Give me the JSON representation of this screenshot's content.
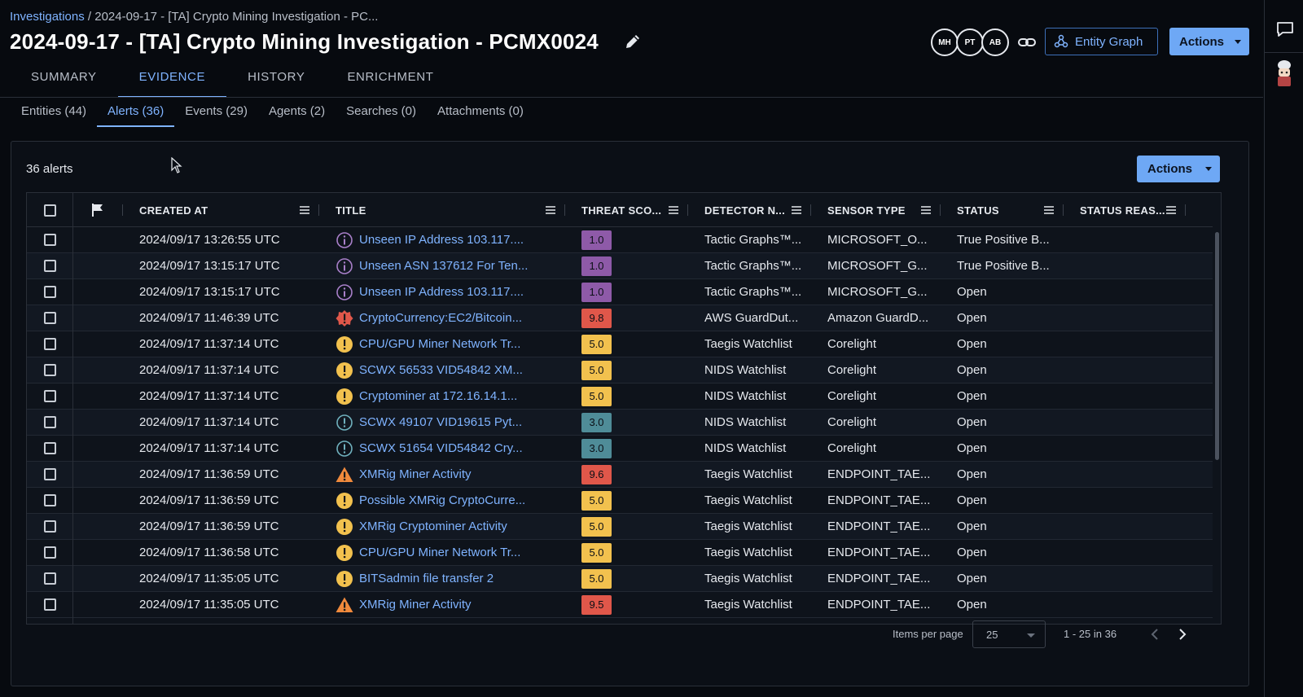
{
  "breadcrumb": {
    "root": "Investigations",
    "separator": " / ",
    "current": "2024-09-17 - [TA] Crypto Mining Investigation - PC..."
  },
  "page_title": "2024-09-17 - [TA] Crypto Mining Investigation - PCMX0024",
  "header": {
    "avatars": [
      "MH",
      "PT",
      "AB"
    ],
    "entity_graph_label": "Entity Graph",
    "actions_label": "Actions"
  },
  "tabs": [
    "SUMMARY",
    "EVIDENCE",
    "HISTORY",
    "ENRICHMENT"
  ],
  "active_tab": "EVIDENCE",
  "subtabs": [
    "Entities (44)",
    "Alerts (36)",
    "Events (29)",
    "Agents (2)",
    "Searches (0)",
    "Attachments (0)"
  ],
  "active_subtab": "Alerts (36)",
  "alerts": {
    "count_label": "36 alerts",
    "actions_label": "Actions",
    "columns": [
      "CREATED AT",
      "TITLE",
      "THREAT SCO...",
      "DETECTOR N...",
      "SENSOR TYPE",
      "STATUS",
      "STATUS REAS..."
    ],
    "rows": [
      {
        "created_at": "2024/09/17 13:26:55 UTC",
        "severity_icon": "info-purple-icon",
        "title": "Unseen IP Address 103.117....",
        "score": "1.0",
        "score_color": "#8e5aa8",
        "detector": "Tactic Graphs™...",
        "sensor": "MICROSOFT_O...",
        "status": "True Positive B...",
        "status_reason": ""
      },
      {
        "created_at": "2024/09/17 13:15:17 UTC",
        "severity_icon": "info-purple-icon",
        "title": "Unseen ASN 137612 For Ten...",
        "score": "1.0",
        "score_color": "#8e5aa8",
        "detector": "Tactic Graphs™...",
        "sensor": "MICROSOFT_G...",
        "status": "True Positive B...",
        "status_reason": ""
      },
      {
        "created_at": "2024/09/17 13:15:17 UTC",
        "severity_icon": "info-purple-icon",
        "title": "Unseen IP Address 103.117....",
        "score": "1.0",
        "score_color": "#8e5aa8",
        "detector": "Tactic Graphs™...",
        "sensor": "MICROSOFT_G...",
        "status": "Open",
        "status_reason": ""
      },
      {
        "created_at": "2024/09/17 11:46:39 UTC",
        "severity_icon": "critical-red-icon",
        "title": "CryptoCurrency:EC2/Bitcoin...",
        "score": "9.8",
        "score_color": "#e0574a",
        "detector": "AWS GuardDut...",
        "sensor": "Amazon GuardD...",
        "status": "Open",
        "status_reason": ""
      },
      {
        "created_at": "2024/09/17 11:37:14 UTC",
        "severity_icon": "warning-yellow-icon",
        "title": "CPU/GPU Miner Network Tr...",
        "score": "5.0",
        "score_color": "#f2c14e",
        "detector": "Taegis Watchlist",
        "sensor": "Corelight",
        "status": "Open",
        "status_reason": ""
      },
      {
        "created_at": "2024/09/17 11:37:14 UTC",
        "severity_icon": "warning-yellow-icon",
        "title": "SCWX 56533 VID54842 XM...",
        "score": "5.0",
        "score_color": "#f2c14e",
        "detector": "NIDS Watchlist",
        "sensor": "Corelight",
        "status": "Open",
        "status_reason": ""
      },
      {
        "created_at": "2024/09/17 11:37:14 UTC",
        "severity_icon": "warning-yellow-icon",
        "title": "Cryptominer at 172.16.14.1...",
        "score": "5.0",
        "score_color": "#f2c14e",
        "detector": "NIDS Watchlist",
        "sensor": "Corelight",
        "status": "Open",
        "status_reason": ""
      },
      {
        "created_at": "2024/09/17 11:37:14 UTC",
        "severity_icon": "info-teal-icon",
        "title": "SCWX 49107 VID19615 Pyt...",
        "score": "3.0",
        "score_color": "#4f8c98",
        "detector": "NIDS Watchlist",
        "sensor": "Corelight",
        "status": "Open",
        "status_reason": ""
      },
      {
        "created_at": "2024/09/17 11:37:14 UTC",
        "severity_icon": "info-teal-icon",
        "title": "SCWX 51654 VID54842 Cry...",
        "score": "3.0",
        "score_color": "#4f8c98",
        "detector": "NIDS Watchlist",
        "sensor": "Corelight",
        "status": "Open",
        "status_reason": ""
      },
      {
        "created_at": "2024/09/17 11:36:59 UTC",
        "severity_icon": "alert-triangle-orange-icon",
        "title": "XMRig Miner Activity",
        "score": "9.6",
        "score_color": "#e0574a",
        "detector": "Taegis Watchlist",
        "sensor": "ENDPOINT_TAE...",
        "status": "Open",
        "status_reason": ""
      },
      {
        "created_at": "2024/09/17 11:36:59 UTC",
        "severity_icon": "warning-yellow-icon",
        "title": "Possible XMRig CryptoCurre...",
        "score": "5.0",
        "score_color": "#f2c14e",
        "detector": "Taegis Watchlist",
        "sensor": "ENDPOINT_TAE...",
        "status": "Open",
        "status_reason": ""
      },
      {
        "created_at": "2024/09/17 11:36:59 UTC",
        "severity_icon": "warning-yellow-icon",
        "title": "XMRig Cryptominer Activity",
        "score": "5.0",
        "score_color": "#f2c14e",
        "detector": "Taegis Watchlist",
        "sensor": "ENDPOINT_TAE...",
        "status": "Open",
        "status_reason": ""
      },
      {
        "created_at": "2024/09/17 11:36:58 UTC",
        "severity_icon": "warning-yellow-icon",
        "title": "CPU/GPU Miner Network Tr...",
        "score": "5.0",
        "score_color": "#f2c14e",
        "detector": "Taegis Watchlist",
        "sensor": "ENDPOINT_TAE...",
        "status": "Open",
        "status_reason": ""
      },
      {
        "created_at": "2024/09/17 11:35:05 UTC",
        "severity_icon": "warning-yellow-icon",
        "title": "BITSadmin file transfer 2",
        "score": "5.0",
        "score_color": "#f2c14e",
        "detector": "Taegis Watchlist",
        "sensor": "ENDPOINT_TAE...",
        "status": "Open",
        "status_reason": ""
      },
      {
        "created_at": "2024/09/17 11:35:05 UTC",
        "severity_icon": "alert-triangle-orange-icon",
        "title": "XMRig Miner Activity",
        "score": "9.5",
        "score_color": "#e0574a",
        "detector": "Taegis Watchlist",
        "sensor": "ENDPOINT_TAE...",
        "status": "Open",
        "status_reason": ""
      }
    ]
  },
  "pagination": {
    "items_per_page_label": "Items per page",
    "items_per_page": "25",
    "range": "1 - 25 in 36"
  },
  "colors": {
    "accent": "#7fb3ff",
    "primary_button": "#6ea8f5",
    "background": "#070a0f"
  }
}
